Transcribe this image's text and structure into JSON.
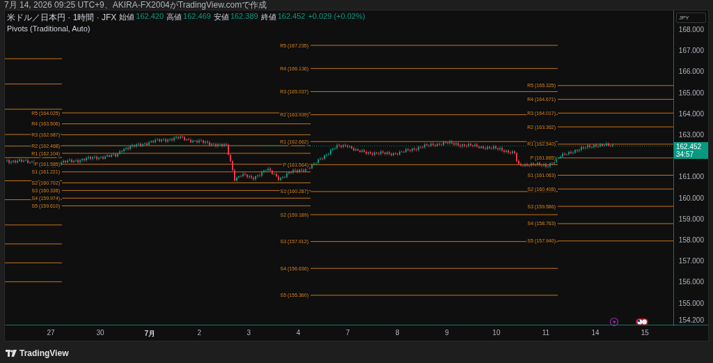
{
  "caption": "7月 14, 2026 09:25 UTC+9、AKIRA-FX2004がTradingView.comで作成",
  "legend": {
    "symbol": "米ドル／日本円 · 1時間 · JFX",
    "ohlc": [
      {
        "label": "始値",
        "value": "162.420"
      },
      {
        "label": "高値",
        "value": "162.469"
      },
      {
        "label": "安値",
        "value": "162.389"
      },
      {
        "label": "終値",
        "value": "162.452"
      }
    ],
    "change": "+0.029 (+0.02%)",
    "indicator": "Pivots (Traditional, Auto)"
  },
  "pivot_periods": [
    {
      "levels": [
        {
          "label": "R5 (164.025)"
        },
        {
          "label": "R4 (163.506)"
        },
        {
          "label": "R3 (162.987)"
        },
        {
          "label": "R2 (162.468)"
        },
        {
          "label": "R1 (162.104)"
        },
        {
          "label": "P (161.585)"
        },
        {
          "label": "S1 (161.221)"
        },
        {
          "label": "S2 (160.702)"
        },
        {
          "label": "S3 (160.338)"
        },
        {
          "label": "S4 (159.974)"
        },
        {
          "label": "S5 (159.610)"
        }
      ]
    },
    {
      "levels": [
        {
          "label": "R5 (167.235)"
        },
        {
          "label": "R4 (166.136)"
        },
        {
          "label": "R3 (165.037)"
        },
        {
          "label": "R2 (163.939)"
        },
        {
          "label": "R1 (162.662)"
        },
        {
          "label": "P (161.564)"
        },
        {
          "label": "S1 (160.287)"
        },
        {
          "label": "S2 (159.189)"
        },
        {
          "label": "S3 (157.912)"
        },
        {
          "label": "S4 (156.636)"
        },
        {
          "label": "S5 (155.360)"
        }
      ]
    },
    {
      "levels": [
        {
          "label": "R5 (165.325)"
        },
        {
          "label": "R4 (164.671)"
        },
        {
          "label": "R3 (164.017)"
        },
        {
          "label": "R2 (163.362)"
        },
        {
          "label": "R1 (162.540)"
        },
        {
          "label": "P (161.885)"
        },
        {
          "label": "S1 (161.063)"
        },
        {
          "label": "S2 (160.408)"
        },
        {
          "label": "S3 (159.586)"
        },
        {
          "label": "S4 (158.763)"
        },
        {
          "label": "S5 (157.940)"
        }
      ]
    }
  ],
  "price_axis": {
    "currency": "JPY",
    "ticks": [
      "168.000",
      "167.000",
      "166.000",
      "165.000",
      "164.000",
      "163.000",
      "161.000",
      "160.000",
      "159.000",
      "158.000",
      "157.000",
      "156.000",
      "155.000",
      "154.200"
    ],
    "last_price": "162.452",
    "countdown": "34:57"
  },
  "time_axis": [
    {
      "label": "27",
      "kind": "day"
    },
    {
      "label": "30",
      "kind": "day"
    },
    {
      "label": "7月",
      "kind": "month"
    },
    {
      "label": "2",
      "kind": "day"
    },
    {
      "label": "3",
      "kind": "day"
    },
    {
      "label": "4",
      "kind": "day"
    },
    {
      "label": "7",
      "kind": "day"
    },
    {
      "label": "8",
      "kind": "day"
    },
    {
      "label": "9",
      "kind": "day"
    },
    {
      "label": "10",
      "kind": "day"
    },
    {
      "label": "11",
      "kind": "day"
    },
    {
      "label": "14",
      "kind": "day"
    },
    {
      "label": "15",
      "kind": "day"
    }
  ],
  "brand": "TradingView"
}
